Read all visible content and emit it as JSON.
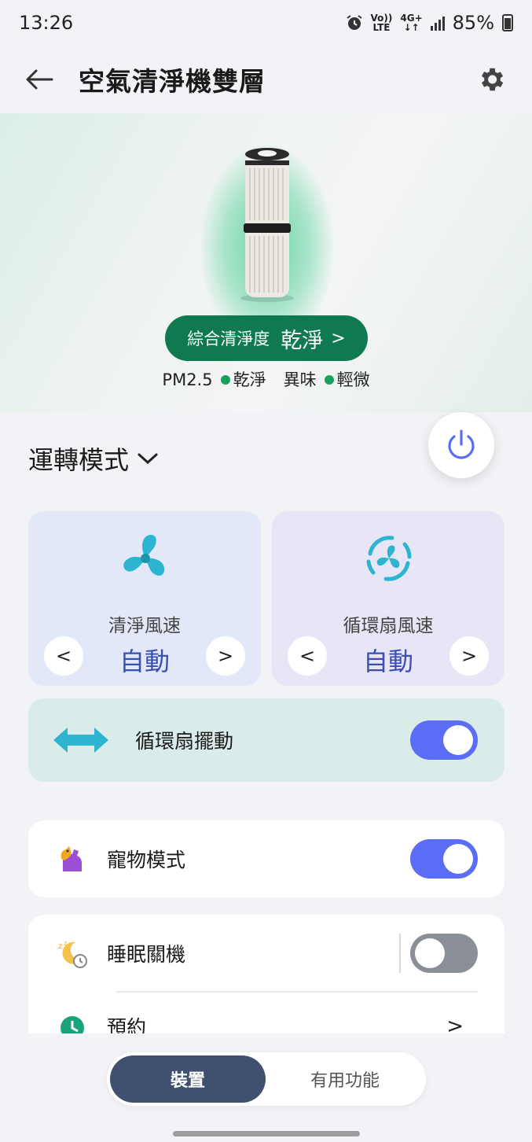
{
  "status_bar": {
    "time": "13:26",
    "network_top": "Vo))",
    "network_bottom": "LTE",
    "data_top": "4G+",
    "data_bottom": "↓↑",
    "battery": "85%",
    "icons": [
      "alarm-icon",
      "signal-icon",
      "battery-icon"
    ]
  },
  "app_bar": {
    "title": "空氣清淨機雙層",
    "back_icon": "arrow-left-icon",
    "settings_icon": "gear-icon"
  },
  "hero": {
    "clean_label": "綜合清淨度",
    "clean_value": "乾淨",
    "clean_chevron": ">",
    "pm_label": "PM2.5",
    "pm_value": "乾淨",
    "odor_label": "異味",
    "odor_value": "輕微",
    "status_color": "#18a05e"
  },
  "mode": {
    "label": "運轉模式",
    "chevron": "⌄"
  },
  "cards": {
    "clean_speed": {
      "label": "清淨風速",
      "value": "自動",
      "prev": "<",
      "next": ">"
    },
    "fan_speed": {
      "label": "循環扇風速",
      "value": "自動",
      "prev": "<",
      "next": ">"
    }
  },
  "swing": {
    "label": "循環扇擺動",
    "on": true
  },
  "pet": {
    "label": "寵物模式",
    "on": true
  },
  "sleep": {
    "label": "睡眠關機",
    "on": false
  },
  "reserve": {
    "label": "預約",
    "chevron": ">"
  },
  "tabs": {
    "device": "裝置",
    "useful": "有用功能"
  },
  "colors": {
    "accent": "#5b6cf5",
    "pill": "#0f7a4f",
    "fan_icon": "#2cb4d1",
    "tab_active": "#3f516f"
  }
}
